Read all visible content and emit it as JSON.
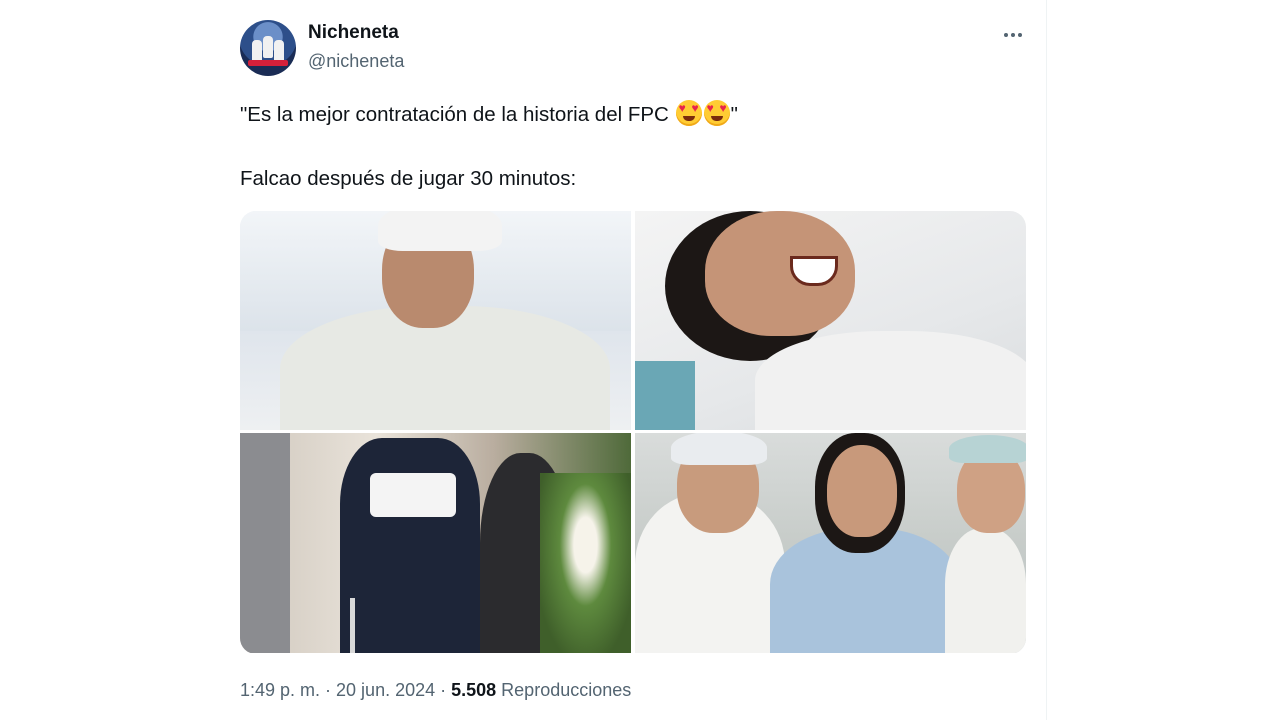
{
  "author": {
    "display_name": "Nicheneta",
    "handle": "@nicheneta"
  },
  "tweet": {
    "text_line1": "\"Es la mejor contratación de la historia del FPC",
    "text_line1_end": "\"",
    "emoji": "smiling-face-with-heart-eyes",
    "text_line2": "Falcao después de jugar 30 minutos:"
  },
  "media": {
    "images": [
      "photo-hospital-bed-surgical-cap",
      "photo-hospital-bed-laughing",
      "photo-crutches",
      "photo-doctors-thumbs-up"
    ]
  },
  "footer": {
    "time_date": "1:49 p. m. · 20 jun. 2024 · ",
    "views_count": "5.508",
    "views_label": " Reproducciones"
  },
  "icons": {
    "more": "more-horizontal-icon"
  },
  "colors": {
    "text": "#0f1419",
    "secondary": "#536471",
    "border": "#eff3f4"
  }
}
